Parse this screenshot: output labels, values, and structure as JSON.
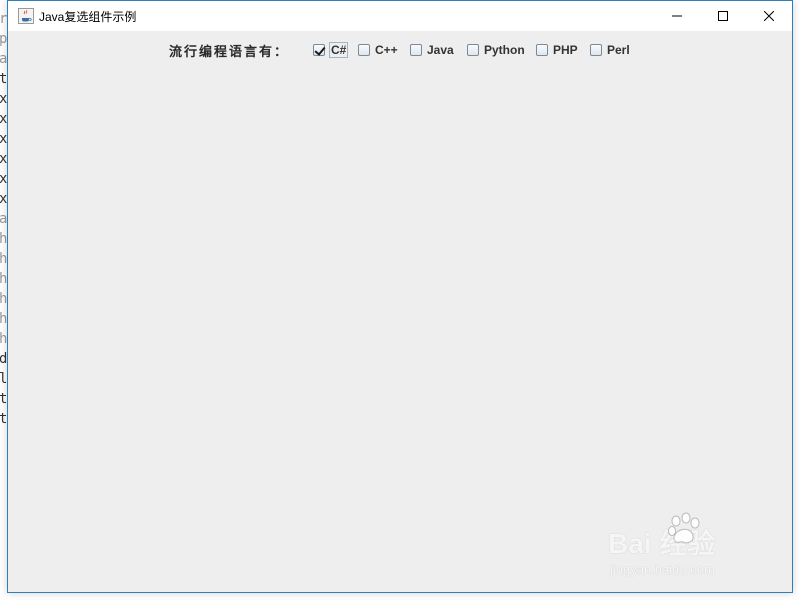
{
  "background": {
    "left_chars": [
      "r",
      "p",
      "a",
      "t",
      "x",
      "x",
      "x",
      "x",
      "x",
      "x",
      "a",
      "h",
      "h",
      "h",
      "h",
      "h",
      "h",
      "d",
      "l",
      "t",
      "t"
    ]
  },
  "window": {
    "title": "Java复选组件示例",
    "icon": "java-cup-icon",
    "controls": {
      "minimize_icon": "minimize-icon",
      "maximize_icon": "maximize-icon",
      "close_icon": "close-icon"
    }
  },
  "form": {
    "prompt": "流行编程语言有：",
    "options": [
      {
        "label": "C#",
        "checked": true
      },
      {
        "label": "C++",
        "checked": false
      },
      {
        "label": "Java",
        "checked": false
      },
      {
        "label": "Python",
        "checked": false
      },
      {
        "label": "PHP",
        "checked": false
      },
      {
        "label": "Perl",
        "checked": false
      }
    ]
  },
  "watermark": {
    "main": "Bai 经验",
    "sub": "jingyan.baidu.com"
  },
  "colors": {
    "window_border": "#2f7fb8",
    "content_bg": "#eeeeee"
  }
}
